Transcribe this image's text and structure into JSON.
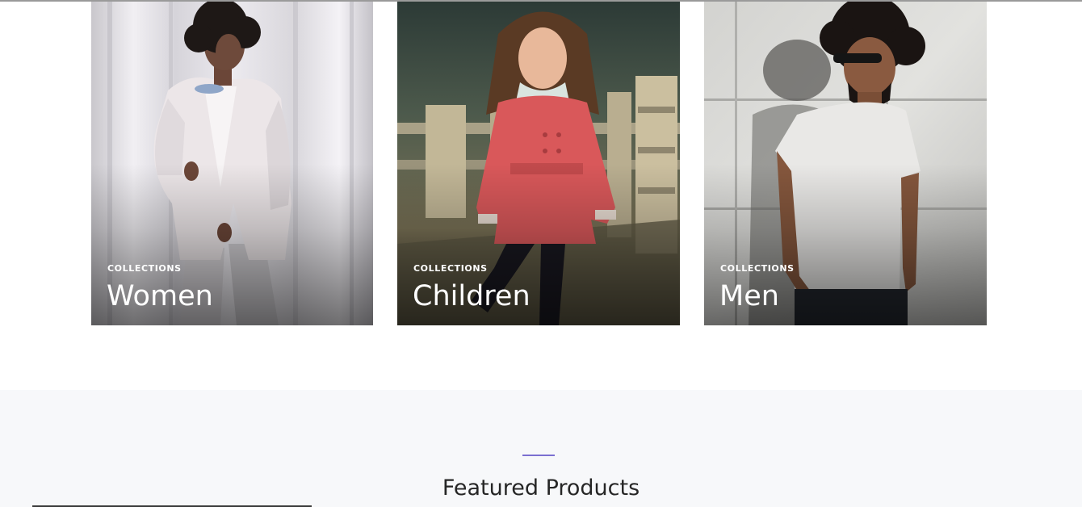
{
  "collections": [
    {
      "eyebrow": "COLLECTIONS",
      "title": "Women"
    },
    {
      "eyebrow": "COLLECTIONS",
      "title": "Children"
    },
    {
      "eyebrow": "COLLECTIONS",
      "title": "Men"
    }
  ],
  "featured": {
    "heading": "Featured Products",
    "accent_color": "#7b6fd0"
  }
}
